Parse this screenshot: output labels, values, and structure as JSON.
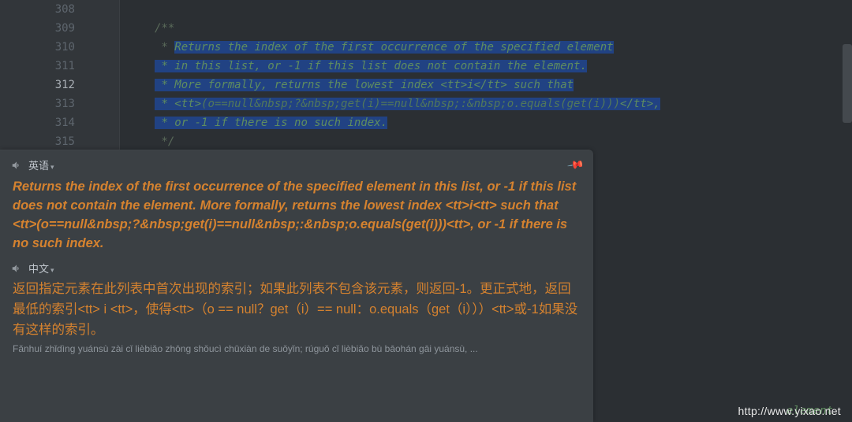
{
  "gutter": {
    "lines": [
      "308",
      "309",
      "310",
      "311",
      "312",
      "313",
      "314",
      "315"
    ],
    "current_index": 4
  },
  "code": {
    "l308": "",
    "l309": "/**",
    "l310_pre": " * ",
    "l310_sel": "Returns the index of the first occurrence of the specified element",
    "l311_pre": " ",
    "l311_sel": "* in this list, or -1 if this list does not contain the element.",
    "l312_pre": " ",
    "l312_sel_a": "* More formally, returns the lowest index ",
    "l312_tag1": "<tt>",
    "l312_mid": "i",
    "l312_tag2": "</tt>",
    "l312_sel_b": " such that",
    "l313_pre": " ",
    "l313_sel_a": "* ",
    "l313_tag1": "<tt>",
    "l313_sel_b": "(o==null&nbsp;?&nbsp;get(i)==null&nbsp;:&nbsp;o.equals(get(i)))",
    "l313_tag2": "</tt>",
    "l313_sel_c": ",",
    "l314_pre": " ",
    "l314_sel": "* or -1 if there is no such index.",
    "l315": " */"
  },
  "popup": {
    "src_lang": "英语",
    "tgt_lang": "中文",
    "pin_label": "pin",
    "english": "Returns the index of the first occurrence of the specified element in this list, or -1 if this list does not contain the element. More formally, returns the lowest index <tt>i<tt> such that <tt>(o==null&nbsp;?&nbsp;get(i)==null&nbsp;:&nbsp;o.equals(get(i)))<tt>, or -1 if there is no such index.",
    "chinese": "返回指定元素在此列表中首次出现的索引；如果此列表不包含该元素，则返回-1。更正式地，返回最低的索引<tt> i <tt>，使得<tt>（o == null？get（i）== null：o.equals（get（i）））<tt>或-1如果没有这样的索引。",
    "pinyin": "Fǎnhuí zhǐdìng yuánsù zài cǐ lièbiǎo zhōng shǒucì chūxiàn de suǒyǐn; rúguǒ cǐ lièbiǎo bù bāohán gāi yuánsù, ..."
  },
  "peek": "element",
  "watermark": "http://www.yixao.net"
}
